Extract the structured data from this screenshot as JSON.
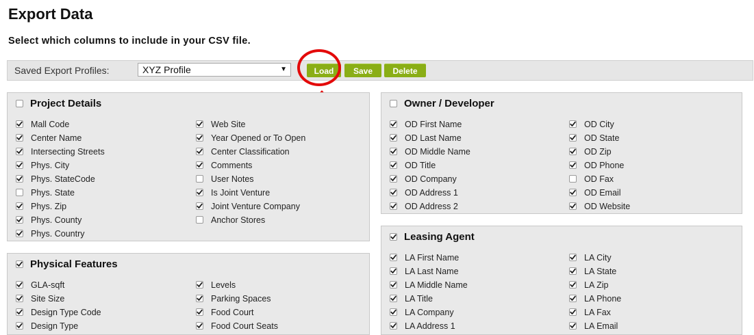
{
  "header": {
    "title": "Export Data",
    "subtitle": "Select which columns to include in your CSV file."
  },
  "profiles": {
    "label": "Saved Export Profiles:",
    "selected": "XYZ Profile",
    "buttons": {
      "load": "Load",
      "save": "Save",
      "delete": "Delete"
    }
  },
  "annotation": {
    "ring_color": "#e30a0a",
    "arrow_color": "#e30a0a"
  },
  "colors": {
    "button": "#8aae16",
    "panel_bg": "#e9e9e9"
  },
  "sections": {
    "project_details": {
      "title": "Project Details",
      "checked": false,
      "left": [
        {
          "label": "Mall Code",
          "checked": true
        },
        {
          "label": "Center Name",
          "checked": true
        },
        {
          "label": "Intersecting Streets",
          "checked": true
        },
        {
          "label": "Phys. City",
          "checked": true
        },
        {
          "label": "Phys. StateCode",
          "checked": true
        },
        {
          "label": "Phys. State",
          "checked": false
        },
        {
          "label": "Phys. Zip",
          "checked": true
        },
        {
          "label": "Phys. County",
          "checked": true
        },
        {
          "label": "Phys. Country",
          "checked": true
        }
      ],
      "right": [
        {
          "label": "Web Site",
          "checked": true
        },
        {
          "label": "Year Opened or To Open",
          "checked": true
        },
        {
          "label": "Center Classification",
          "checked": true
        },
        {
          "label": "Comments",
          "checked": true
        },
        {
          "label": "User Notes",
          "checked": false
        },
        {
          "label": "Is Joint Venture",
          "checked": true
        },
        {
          "label": "Joint Venture Company",
          "checked": true
        },
        {
          "label": "Anchor Stores",
          "checked": false
        }
      ]
    },
    "physical_features": {
      "title": "Physical Features",
      "checked": true,
      "left": [
        {
          "label": "GLA-sqft",
          "checked": true
        },
        {
          "label": "Site Size",
          "checked": true
        },
        {
          "label": "Design Type Code",
          "checked": true
        },
        {
          "label": "Design Type",
          "checked": true
        }
      ],
      "right": [
        {
          "label": "Levels",
          "checked": true
        },
        {
          "label": "Parking Spaces",
          "checked": true
        },
        {
          "label": "Food Court",
          "checked": true
        },
        {
          "label": "Food Court Seats",
          "checked": true
        }
      ]
    },
    "owner_developer": {
      "title": "Owner / Developer",
      "checked": false,
      "left": [
        {
          "label": "OD First Name",
          "checked": true
        },
        {
          "label": "OD Last Name",
          "checked": true
        },
        {
          "label": "OD Middle Name",
          "checked": true
        },
        {
          "label": "OD Title",
          "checked": true
        },
        {
          "label": "OD Company",
          "checked": true
        },
        {
          "label": "OD Address 1",
          "checked": true
        },
        {
          "label": "OD Address 2",
          "checked": true
        }
      ],
      "right": [
        {
          "label": "OD City",
          "checked": true
        },
        {
          "label": "OD State",
          "checked": true
        },
        {
          "label": "OD Zip",
          "checked": true
        },
        {
          "label": "OD Phone",
          "checked": true
        },
        {
          "label": "OD Fax",
          "checked": false
        },
        {
          "label": "OD Email",
          "checked": true
        },
        {
          "label": "OD Website",
          "checked": true
        }
      ]
    },
    "leasing_agent": {
      "title": "Leasing Agent",
      "checked": true,
      "left": [
        {
          "label": "LA First Name",
          "checked": true
        },
        {
          "label": "LA Last Name",
          "checked": true
        },
        {
          "label": "LA Middle Name",
          "checked": true
        },
        {
          "label": "LA Title",
          "checked": true
        },
        {
          "label": "LA Company",
          "checked": true
        },
        {
          "label": "LA Address 1",
          "checked": true
        }
      ],
      "right": [
        {
          "label": "LA City",
          "checked": true
        },
        {
          "label": "LA State",
          "checked": true
        },
        {
          "label": "LA Zip",
          "checked": true
        },
        {
          "label": "LA Phone",
          "checked": true
        },
        {
          "label": "LA Fax",
          "checked": true
        },
        {
          "label": "LA Email",
          "checked": true
        }
      ]
    }
  }
}
